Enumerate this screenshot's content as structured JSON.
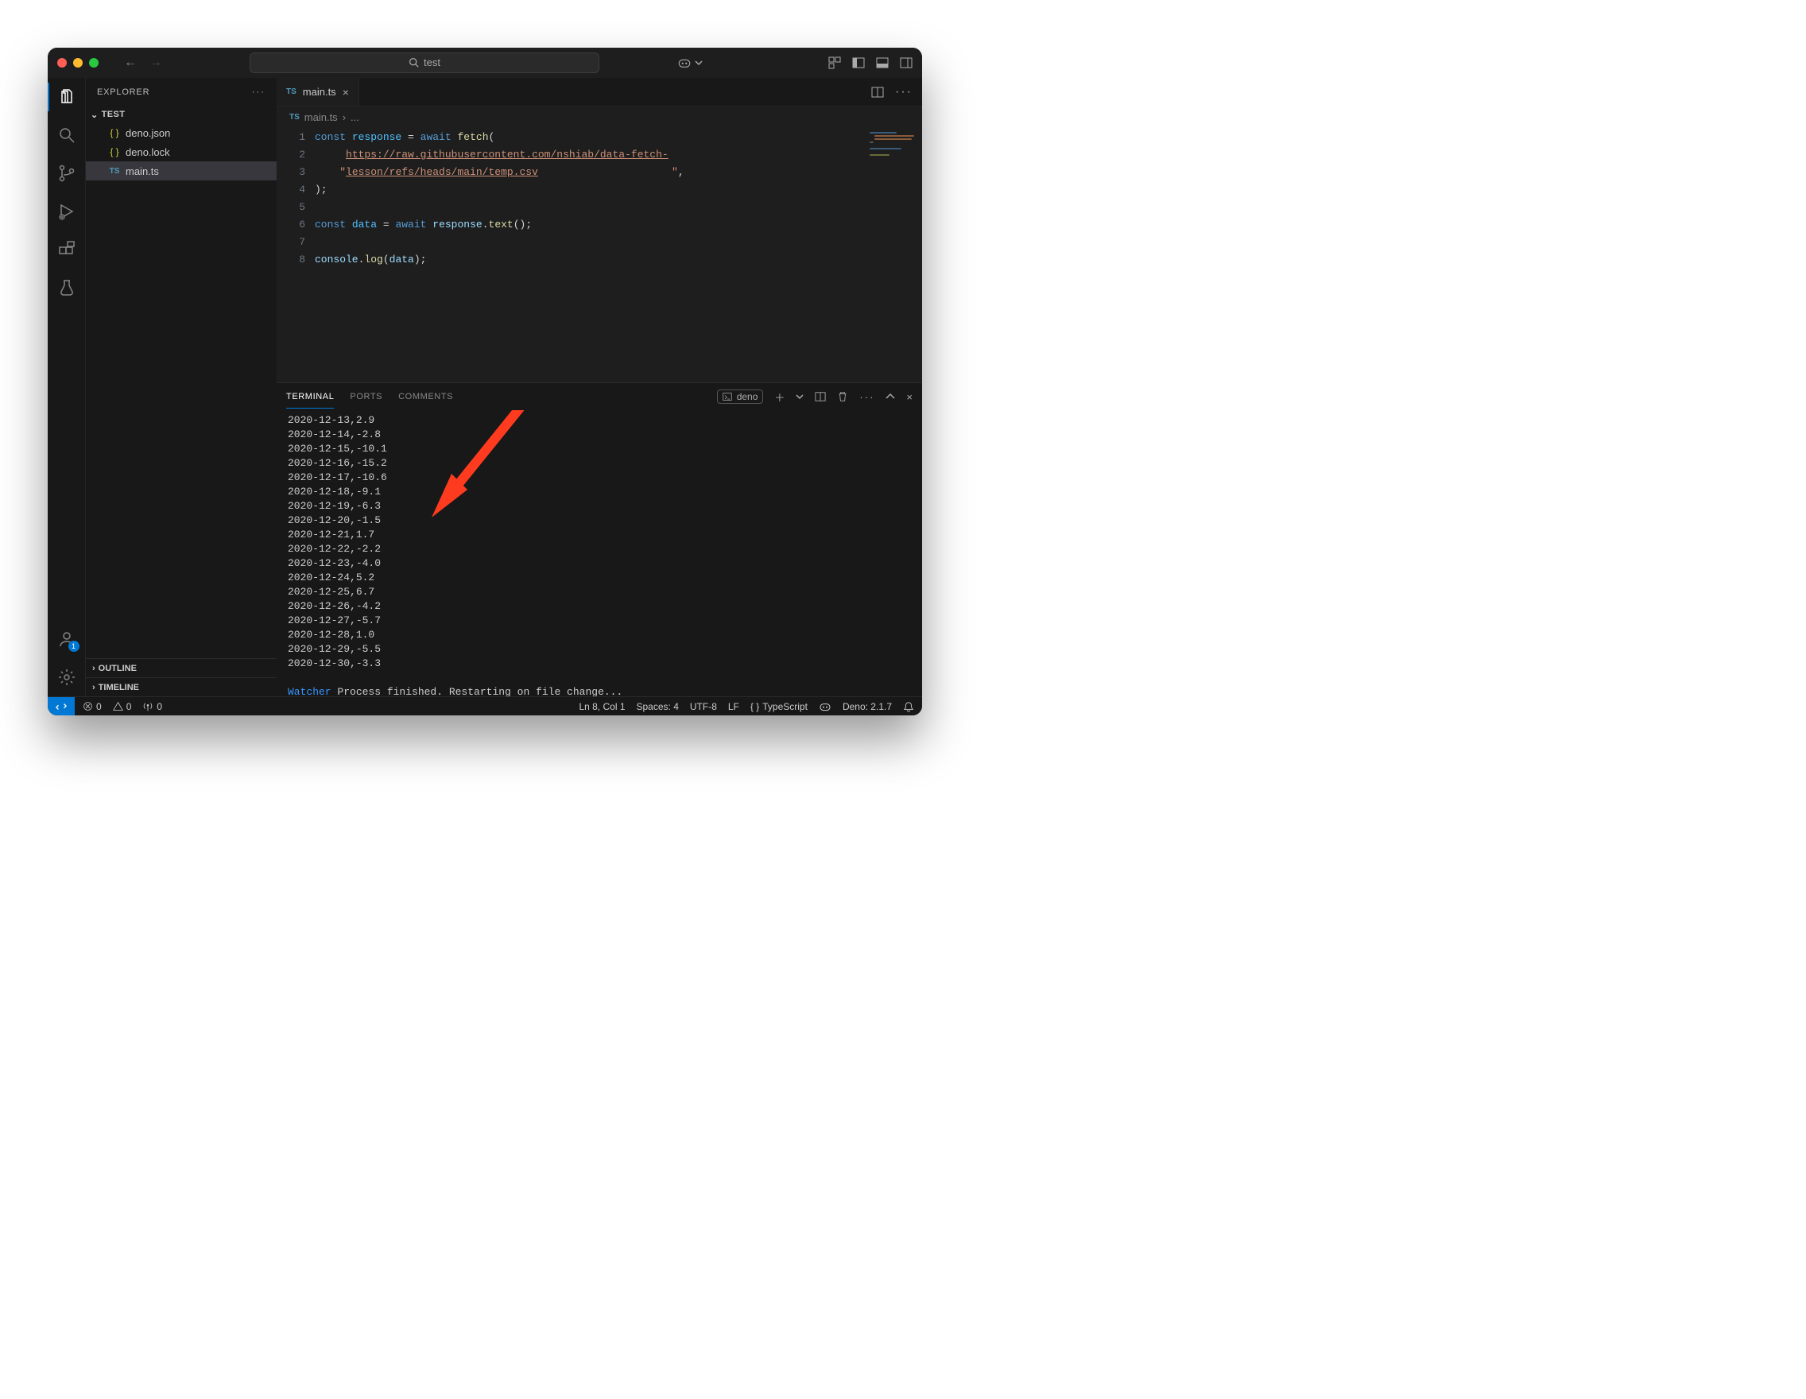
{
  "titlebar": {
    "search_text": "test",
    "nav_back": "←",
    "nav_fwd": "→"
  },
  "sidebar": {
    "title": "EXPLORER",
    "root": "TEST",
    "files": [
      {
        "name": "deno.json",
        "icon": "json"
      },
      {
        "name": "deno.lock",
        "icon": "json"
      },
      {
        "name": "main.ts",
        "icon": "ts",
        "selected": true
      }
    ],
    "outline": "OUTLINE",
    "timeline": "TIMELINE"
  },
  "accounts_badge": "1",
  "tabs": {
    "open": [
      {
        "name": "main.ts",
        "icon": "ts",
        "active": true
      }
    ]
  },
  "breadcrumb": {
    "file": "main.ts",
    "rest": "..."
  },
  "code": {
    "line_numbers": [
      "1",
      "2",
      "3",
      "4",
      "5",
      "6",
      "7",
      "8"
    ],
    "l1_kw1": "const",
    "l1_var": "response",
    "l1_eq": " = ",
    "l1_kw2": "await",
    "l1_fn": "fetch",
    "l1_paren": "(",
    "l2_indent": "    ",
    "l2_q1": "\"",
    "l2_url": "https://raw.githubusercontent.com/nshiab/data-fetch-lesson/refs/heads/main/temp.csv",
    "l2_q2": "\"",
    "l2_comma": ",",
    "l3_close": ");",
    "l4": "",
    "l5_kw1": "const",
    "l5_var": "data",
    "l5_eq": " = ",
    "l5_kw2": "await",
    "l5_sp": " ",
    "l5_obj": "response",
    "l5_dot": ".",
    "l5_fn": "text",
    "l5_call": "();",
    "l6": "",
    "l7_obj": "console",
    "l7_dot": ".",
    "l7_fn": "log",
    "l7_p1": "(",
    "l7_arg": "data",
    "l7_p2": ");",
    "l8": ""
  },
  "panel": {
    "tabs": {
      "terminal": "TERMINAL",
      "ports": "PORTS",
      "comments": "COMMENTS"
    },
    "term_label": "deno",
    "output_lines": [
      "2020-12-13,2.9",
      "2020-12-14,-2.8",
      "2020-12-15,-10.1",
      "2020-12-16,-15.2",
      "2020-12-17,-10.6",
      "2020-12-18,-9.1",
      "2020-12-19,-6.3",
      "2020-12-20,-1.5",
      "2020-12-21,1.7",
      "2020-12-22,-2.2",
      "2020-12-23,-4.0",
      "2020-12-24,5.2",
      "2020-12-25,6.7",
      "2020-12-26,-4.2",
      "2020-12-27,-5.7",
      "2020-12-28,1.0",
      "2020-12-29,-5.5",
      "2020-12-30,-3.3"
    ],
    "watcher_label": "Watcher",
    "watcher_msg": " Process finished. Restarting on file change..."
  },
  "statusbar": {
    "errors": "0",
    "warnings": "0",
    "port": "0",
    "cursor": "Ln 8, Col 1",
    "spaces": "Spaces: 4",
    "encoding": "UTF-8",
    "eol": "LF",
    "lang": "TypeScript",
    "deno": "Deno: 2.1.7"
  }
}
